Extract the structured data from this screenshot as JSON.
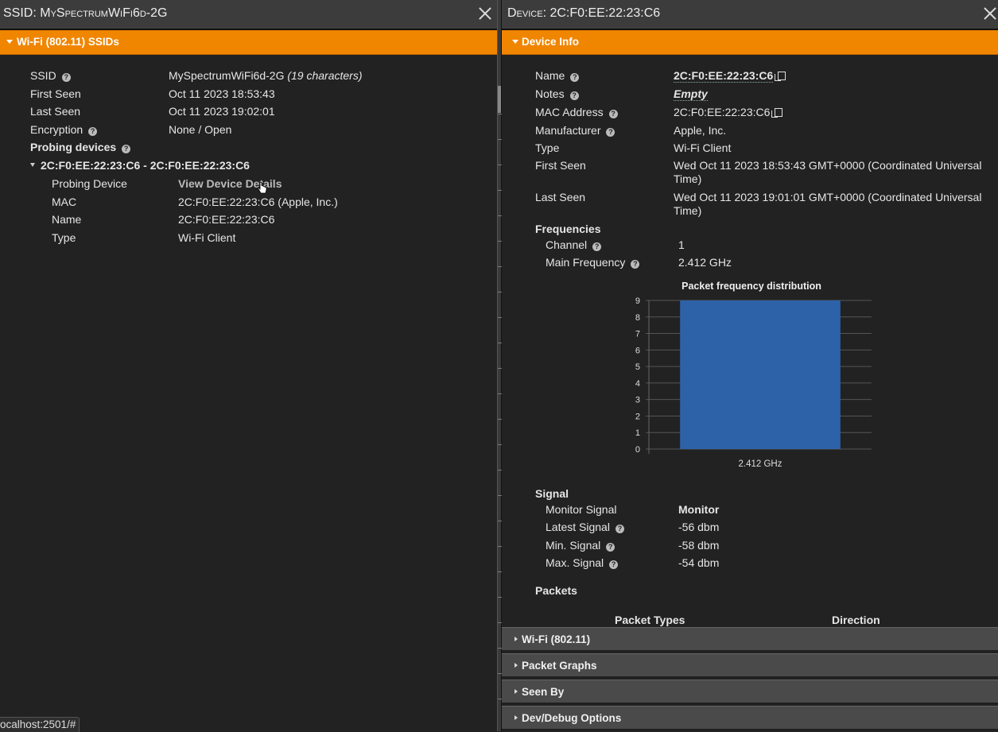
{
  "left": {
    "title_prefix": "SSID: ",
    "title_name": "MySpectrumWiFi6d-2G",
    "section_label": "Wi-Fi (802.11) SSIDs",
    "rows": [
      {
        "label": "SSID",
        "value": "MySpectrumWiFi6d-2G",
        "note": "(19 characters)"
      },
      {
        "label": "First Seen",
        "value": "Oct 11 2023 18:53:43"
      },
      {
        "label": "Last Seen",
        "value": "Oct 11 2023 19:02:01"
      },
      {
        "label": "Encryption",
        "value": "None / Open"
      }
    ],
    "probing_label": "Probing devices",
    "probe_group": "2C:F0:EE:22:23:C6 - 2C:F0:EE:22:23:C6",
    "probe_rows": [
      {
        "label": "Probing Device",
        "value": "View Device Details"
      },
      {
        "label": "MAC",
        "value": "2C:F0:EE:22:23:C6 (Apple, Inc.)"
      },
      {
        "label": "Name",
        "value": "2C:F0:EE:22:23:C6"
      },
      {
        "label": "Type",
        "value": "Wi-Fi Client"
      }
    ]
  },
  "right": {
    "title": "Device: 2C:F0:EE:22:23:C6",
    "section_label": "Device Info",
    "rows": [
      {
        "label": "Name",
        "value": "2C:F0:EE:22:23:C6"
      },
      {
        "label": "Notes",
        "value": "Empty"
      },
      {
        "label": "MAC Address",
        "value": "2C:F0:EE:22:23:C6"
      },
      {
        "label": "Manufacturer",
        "value": "Apple, Inc."
      },
      {
        "label": "Type",
        "value": "Wi-Fi Client"
      },
      {
        "label": "First Seen",
        "value_line1": "Wed Oct 11 2023 18:53:43 GMT+0000 (Coordinated Universal",
        "value_line2": "Time)"
      },
      {
        "label": "Last Seen",
        "value_line1": "Wed Oct 11 2023 19:01:01 GMT+0000 (Coordinated Universal",
        "value_line2": "Time)"
      }
    ],
    "frequencies_label": "Frequencies",
    "freq_rows": [
      {
        "label": "Channel",
        "value": "1"
      },
      {
        "label": "Main Frequency",
        "value": "2.412 GHz"
      }
    ],
    "signal_label": "Signal",
    "signal_rows": [
      {
        "label": "Monitor Signal",
        "value": "Monitor"
      },
      {
        "label": "Latest Signal",
        "value": "-56 dbm"
      },
      {
        "label": "Min. Signal",
        "value": "-58 dbm"
      },
      {
        "label": "Max. Signal",
        "value": "-54 dbm"
      }
    ],
    "packets_label": "Packets",
    "packet_types_label": "Packet Types",
    "direction_label": "Direction",
    "collapsed_sections": [
      "Wi-Fi (802.11)",
      "Packet Graphs",
      "Seen By",
      "Dev/Debug Options"
    ]
  },
  "chart_data": {
    "type": "bar",
    "title": "Packet frequency distribution",
    "categories": [
      "2.412 GHz"
    ],
    "values": [
      9
    ],
    "ylim": [
      0,
      9
    ],
    "yticks": [
      "0",
      "1",
      "2",
      "3",
      "4",
      "5",
      "6",
      "7",
      "8",
      "9"
    ],
    "bar_color": "#2e62a8",
    "grid": true
  },
  "status_bar": "ocalhost:2501/#",
  "colors": {
    "accent": "#f08500",
    "background": "#222222"
  }
}
